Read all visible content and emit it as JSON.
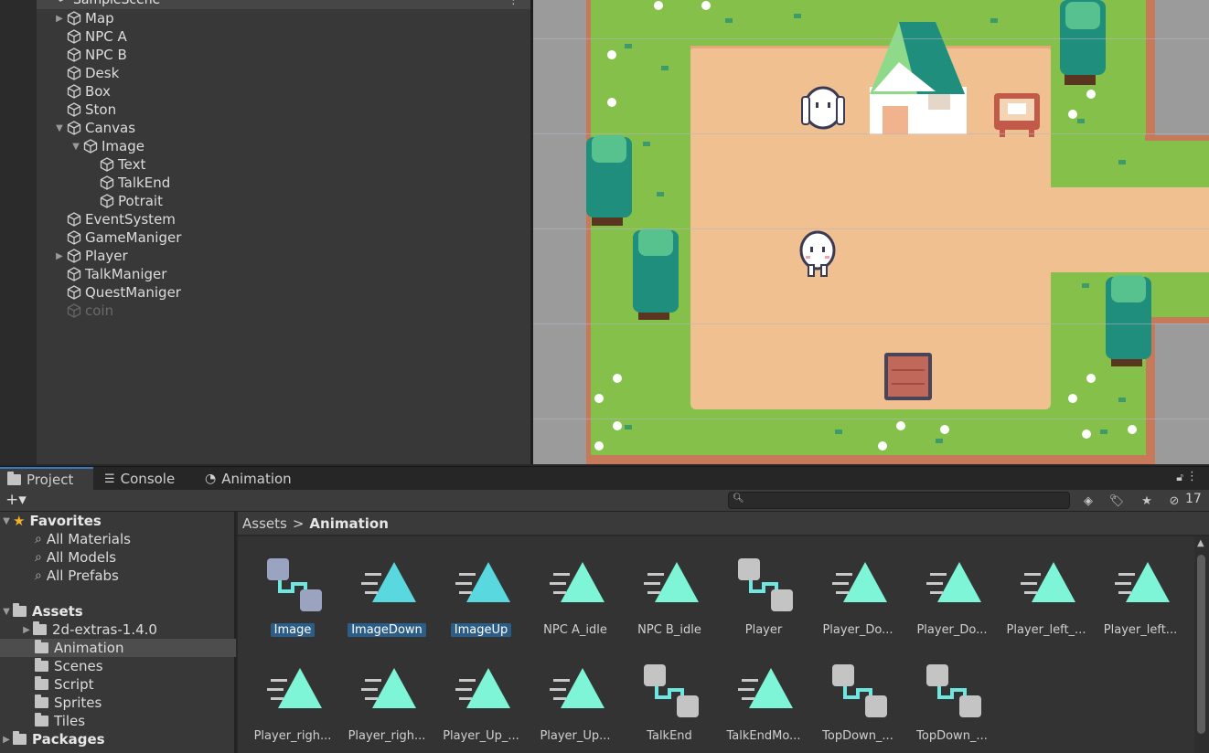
{
  "hierarchy": {
    "scene_name": "SampleScene",
    "items": [
      {
        "label": "Map",
        "arrow": "▶"
      },
      {
        "label": "NPC A",
        "arrow": ""
      },
      {
        "label": "NPC B",
        "arrow": ""
      },
      {
        "label": "Desk",
        "arrow": ""
      },
      {
        "label": "Box",
        "arrow": ""
      },
      {
        "label": "Ston",
        "arrow": ""
      },
      {
        "label": "Canvas",
        "arrow": "▼"
      },
      {
        "label": "Image",
        "arrow": "▼"
      },
      {
        "label": "Text",
        "arrow": ""
      },
      {
        "label": "TalkEnd",
        "arrow": ""
      },
      {
        "label": "Potrait",
        "arrow": ""
      },
      {
        "label": "EventSystem",
        "arrow": ""
      },
      {
        "label": "GameManiger",
        "arrow": ""
      },
      {
        "label": "Player",
        "arrow": "▶"
      },
      {
        "label": "TalkManiger",
        "arrow": ""
      },
      {
        "label": "QuestManiger",
        "arrow": ""
      },
      {
        "label": "coin",
        "arrow": ""
      }
    ]
  },
  "tabs": [
    {
      "label": "Project",
      "icon": "folder-icon"
    },
    {
      "label": "Console",
      "icon": "console-icon"
    },
    {
      "label": "Animation",
      "icon": "clock-icon"
    }
  ],
  "toolbar": {
    "add_label": "+▾",
    "search_placeholder": "",
    "hidden_count": "17"
  },
  "favorites": {
    "title": "Favorites",
    "items": [
      "All Materials",
      "All Models",
      "All Prefabs"
    ]
  },
  "assets_tree": {
    "title": "Assets",
    "items": [
      "2d-extras-1.4.0",
      "Animation",
      "Scenes",
      "Script",
      "Sprites",
      "Tiles"
    ],
    "packages": "Packages"
  },
  "breadcrumb": {
    "root": "Assets",
    "separator": ">",
    "current": "Animation"
  },
  "assets": [
    {
      "label": "Image",
      "type": "controller",
      "selected": true
    },
    {
      "label": "ImageDown",
      "type": "clip",
      "selected": true
    },
    {
      "label": "ImageUp",
      "type": "clip",
      "selected": true
    },
    {
      "label": "NPC A_idle",
      "type": "clip",
      "selected": false
    },
    {
      "label": "NPC B_idle",
      "type": "clip",
      "selected": false
    },
    {
      "label": "Player",
      "type": "controller",
      "selected": false
    },
    {
      "label": "Player_Do...",
      "type": "clip",
      "selected": false
    },
    {
      "label": "Player_Do...",
      "type": "clip",
      "selected": false
    },
    {
      "label": "Player_left_...",
      "type": "clip",
      "selected": false
    },
    {
      "label": "Player_left...",
      "type": "clip",
      "selected": false
    },
    {
      "label": "Player_righ...",
      "type": "clip",
      "selected": false
    },
    {
      "label": "Player_righ...",
      "type": "clip",
      "selected": false
    },
    {
      "label": "Player_Up_...",
      "type": "clip",
      "selected": false
    },
    {
      "label": "Player_Up...",
      "type": "clip",
      "selected": false
    },
    {
      "label": "TalkEnd",
      "type": "controller",
      "selected": false
    },
    {
      "label": "TalkEndMo...",
      "type": "clip",
      "selected": false
    },
    {
      "label": "TopDown_...",
      "type": "controller",
      "selected": false
    },
    {
      "label": "TopDown_...",
      "type": "controller",
      "selected": false
    }
  ],
  "colors": {
    "clip_teal": "#7ff5d8",
    "clip_teal_selected": "#5ad8e0",
    "controller_teal": "#6fe6df",
    "selection_blue": "#2c5d87",
    "tab_accent": "#3a79bb",
    "grass": "#84c04a",
    "dirt": "#f0c091"
  }
}
